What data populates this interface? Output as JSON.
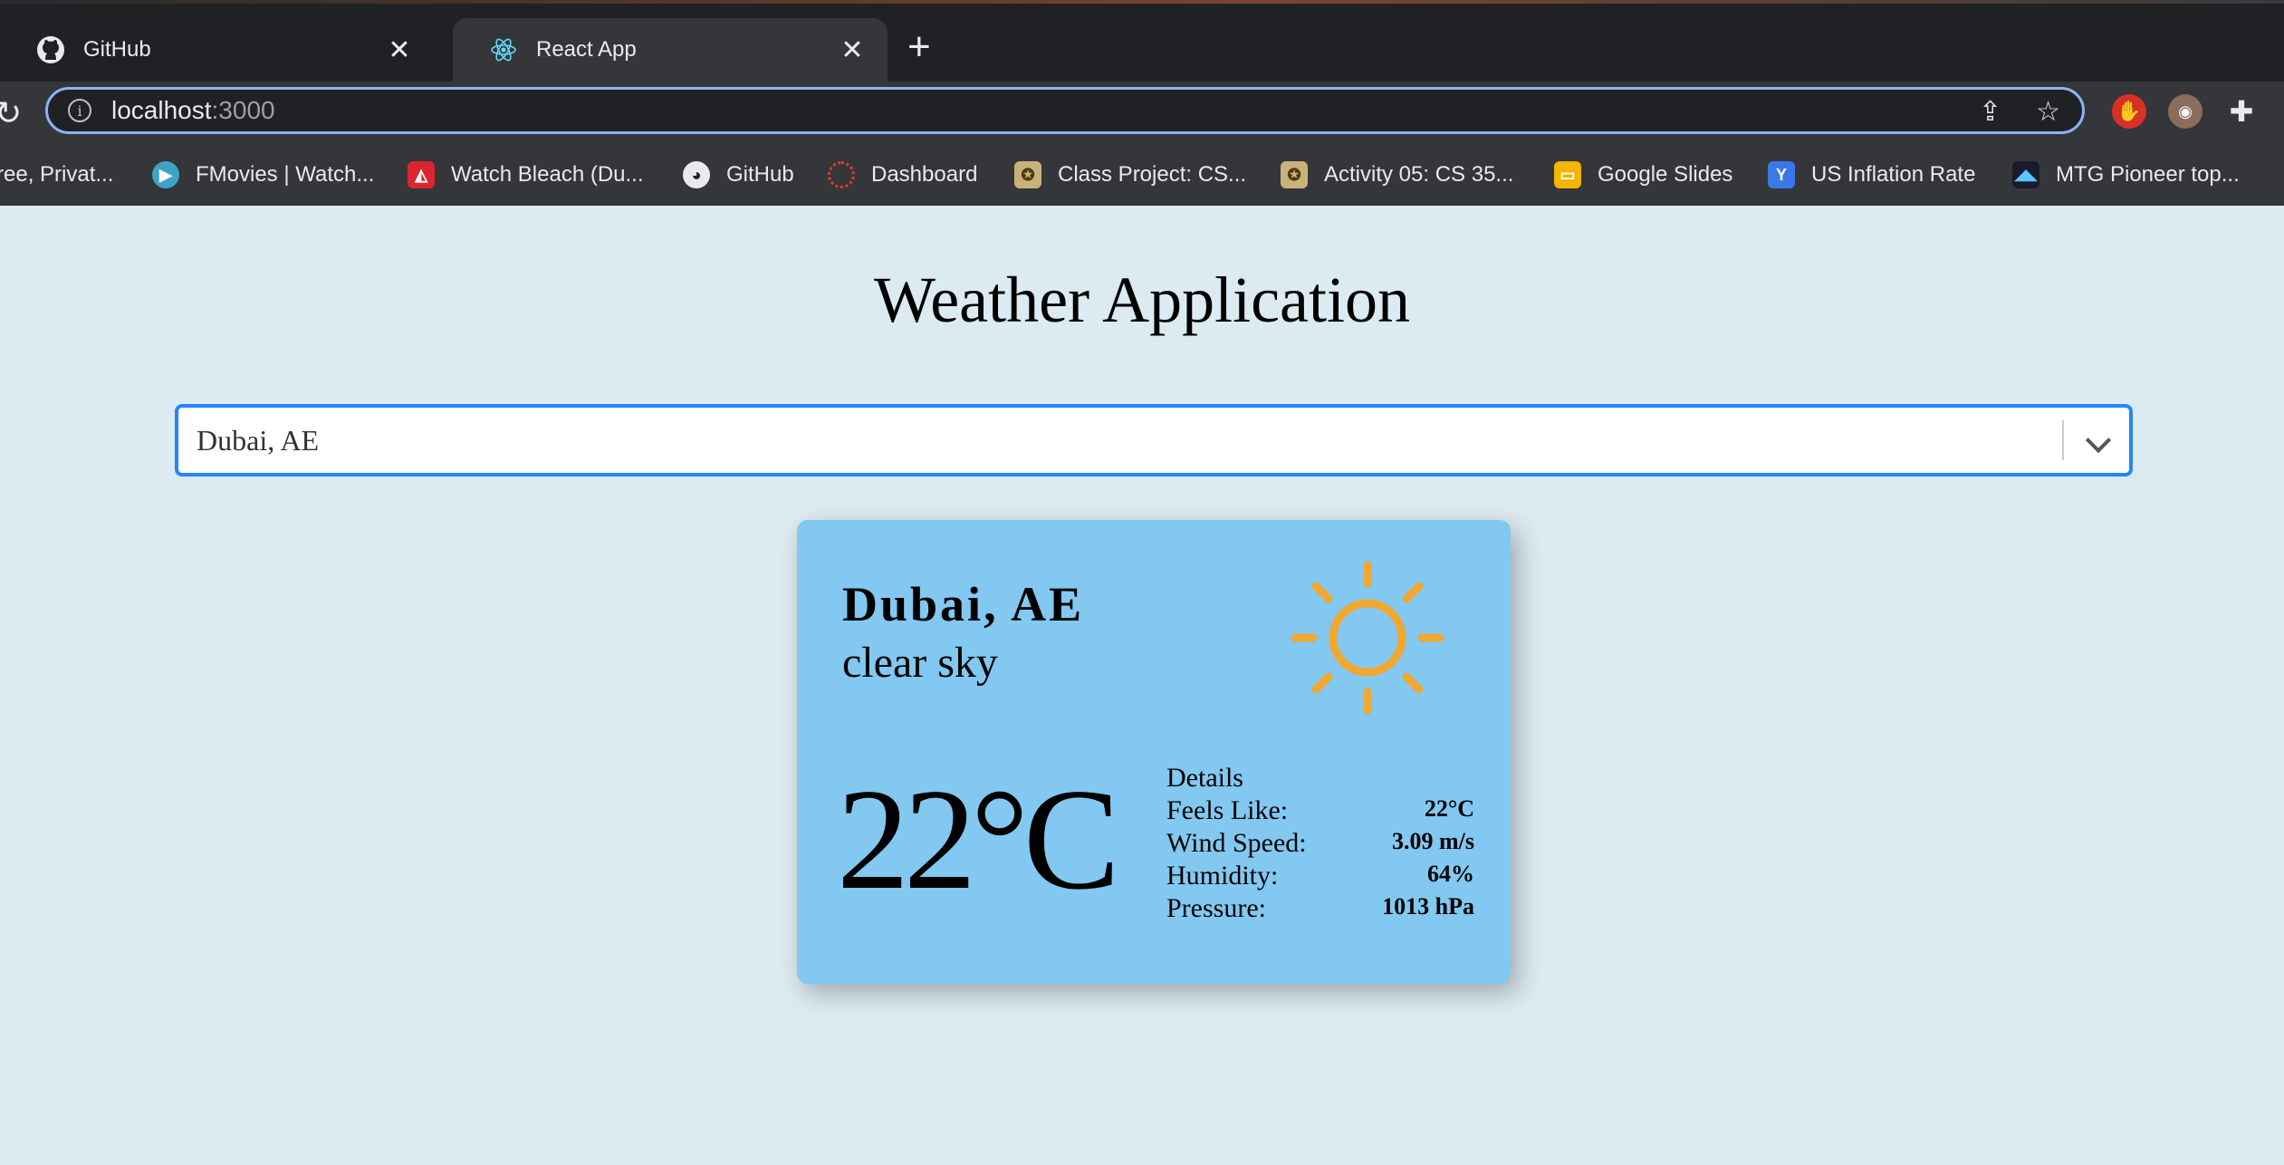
{
  "browser": {
    "tabs": [
      {
        "title": "GitHub",
        "icon": "github-icon",
        "active": false
      },
      {
        "title": "React App",
        "icon": "react-icon",
        "active": true
      }
    ],
    "new_tab_symbol": "+",
    "close_symbol": "✕",
    "url_host": "localhost",
    "url_port": ":3000",
    "bookmarks": [
      {
        "label": "ree, Privat...",
        "icon": "none"
      },
      {
        "label": "FMovies | Watch...",
        "icon": "play-icon",
        "color": "#3da4c8"
      },
      {
        "label": "Watch Bleach (Du...",
        "icon": "bleach-icon",
        "color": "#d9262f"
      },
      {
        "label": "GitHub",
        "icon": "github-icon"
      },
      {
        "label": "Dashboard",
        "icon": "canvas-icon",
        "color": "#e03e2d"
      },
      {
        "label": "Class Project: CS...",
        "icon": "seal-icon",
        "color": "#c9b27a"
      },
      {
        "label": "Activity 05: CS 35...",
        "icon": "seal-icon",
        "color": "#c9b27a"
      },
      {
        "label": "Google Slides",
        "icon": "slides-icon",
        "color": "#f4b400"
      },
      {
        "label": "US Inflation Rate",
        "icon": "y-icon",
        "color": "#3b78e7"
      },
      {
        "label": "MTG Pioneer top...",
        "icon": "mtg-icon",
        "color": "#1a1a2e"
      }
    ]
  },
  "app": {
    "title": "Weather Application",
    "search": {
      "value": "Dubai, AE"
    },
    "card": {
      "city": "Dubai, AE",
      "description": "clear sky",
      "icon": "sun-icon",
      "icon_color": "#f0a830",
      "temperature": "22°C",
      "details_heading": "Details",
      "details": [
        {
          "label": "Feels Like:",
          "value": "22°C"
        },
        {
          "label": "Wind Speed:",
          "value": "3.09 m/s"
        },
        {
          "label": "Humidity:",
          "value": "64%"
        },
        {
          "label": "Pressure:",
          "value": "1013 hPa"
        }
      ]
    }
  },
  "colors": {
    "page_bg": "#dceaf1",
    "card_bg": "#82c8f0",
    "select_border": "#2684ff",
    "omnibox_border": "#8ab4f8"
  }
}
